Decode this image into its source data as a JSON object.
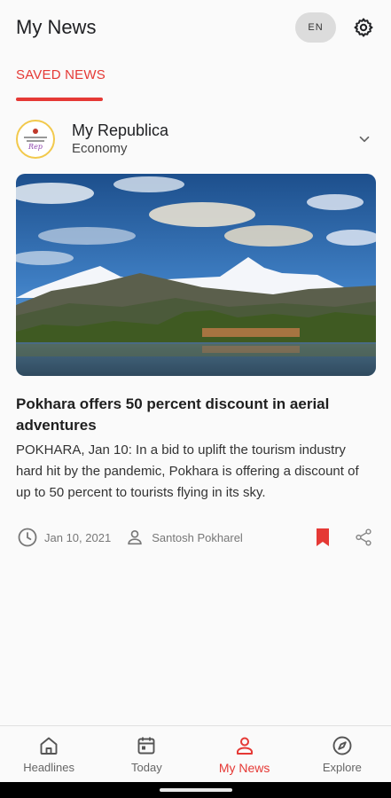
{
  "header": {
    "title": "My News",
    "language": "EN",
    "settings_icon": "gear-icon"
  },
  "tabs": [
    {
      "label": "SAVED NEWS",
      "active": true
    }
  ],
  "article": {
    "source": {
      "name": "My Republica",
      "category": "Economy"
    },
    "headline": "Pokhara offers 50 percent discount in aerial adventures",
    "summary": "POKHARA, Jan 10: In a bid to uplift the tourism industry hard hit by the pandemic, Pokhara is offering a discount of up to 50 percent to tourists flying in its sky.",
    "date": "Jan 10, 2021",
    "author": "Santosh Pokharel",
    "bookmarked": true
  },
  "bottom_nav": [
    {
      "label": "Headlines",
      "icon": "home-icon",
      "active": false
    },
    {
      "label": "Today",
      "icon": "calendar-icon",
      "active": false
    },
    {
      "label": "My News",
      "icon": "person-icon",
      "active": true
    },
    {
      "label": "Explore",
      "icon": "compass-icon",
      "active": false
    }
  ],
  "colors": {
    "accent": "#e53935",
    "background": "#fafafa",
    "text": "#1f1f1f",
    "muted": "#777777"
  }
}
